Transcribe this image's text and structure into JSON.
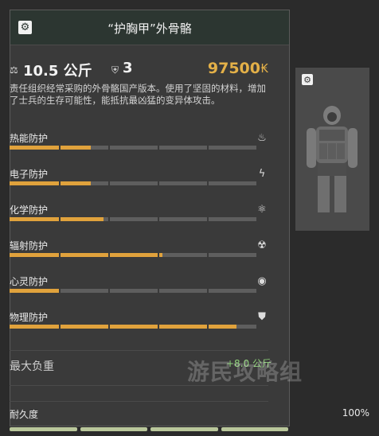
{
  "item": {
    "title": "“护胸甲”外骨骼",
    "weight": "10.5 公斤",
    "slots": "3",
    "price": "97500",
    "currency_symbol": "₭",
    "description": "责任组织经常采购的外骨骼国产版本。使用了坚固的材料，增加了士兵的生存可能性，能抵抗最凶猛的变异体攻击。"
  },
  "protections": [
    {
      "label": "热能防护",
      "icon": "fire-icon",
      "glyph": "♨",
      "level": 0.33
    },
    {
      "label": "电子防护",
      "icon": "electric-shield-icon",
      "glyph": "ϟ",
      "level": 0.33
    },
    {
      "label": "化学防护",
      "icon": "chemical-icon",
      "glyph": "⚛",
      "level": 0.38
    },
    {
      "label": "辐射防护",
      "icon": "radiation-icon",
      "glyph": "☢",
      "level": 0.62
    },
    {
      "label": "心灵防护",
      "icon": "psy-icon",
      "glyph": "◉",
      "level": 0.2
    },
    {
      "label": "物理防护",
      "icon": "physical-shield-icon",
      "glyph": "⛊",
      "level": 0.92
    }
  ],
  "carry": {
    "label": "最大负重",
    "value": "+8.0 公斤"
  },
  "durability": {
    "label": "耐久度",
    "value": "100%"
  },
  "watermark": "游民攻略组",
  "colors": {
    "bar_fill": "#e0a23c",
    "bar_track": "#5e5e5e",
    "price": "#e3b048"
  }
}
